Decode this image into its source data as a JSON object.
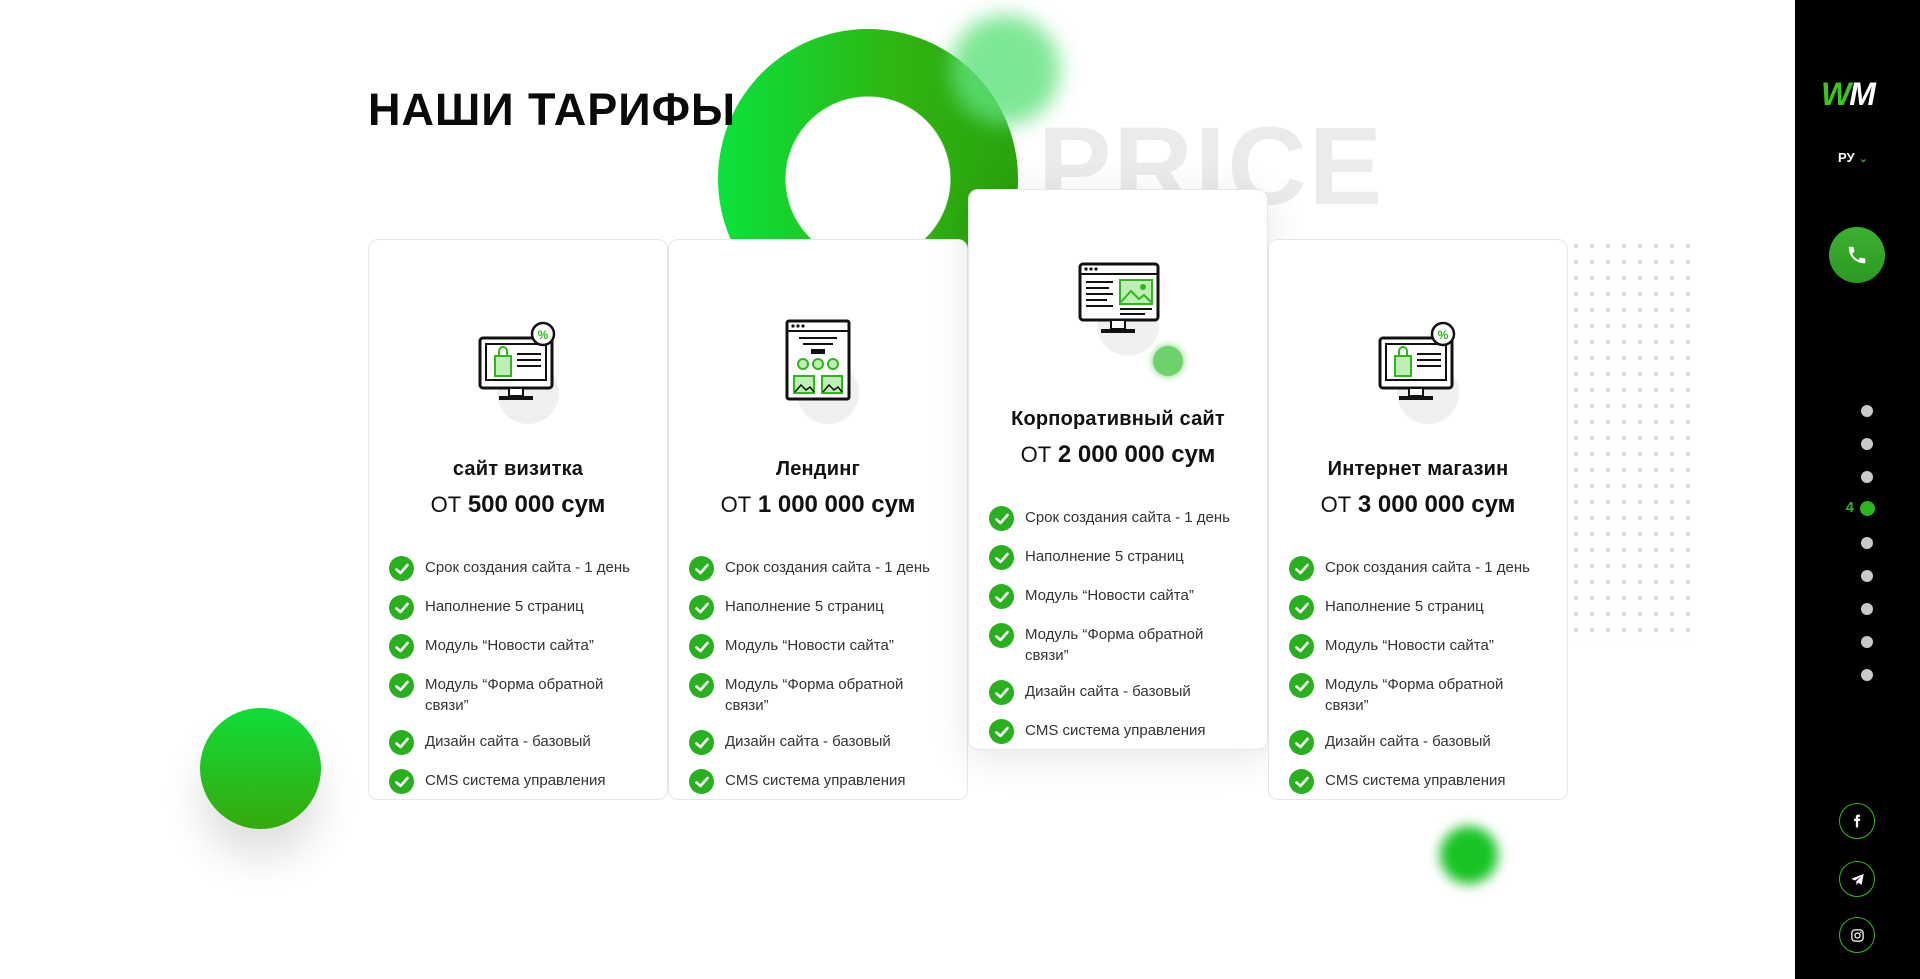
{
  "page": {
    "title": "НАШИ ТАРИФЫ",
    "watermark": "PRICE"
  },
  "colors": {
    "accent": "#2fb61e",
    "sidebar_bg": "#000000"
  },
  "cards": [
    {
      "icon": "shop-monitor-icon",
      "name": "сайт визитка",
      "price_prefix": "ОТ",
      "price": "500 000 сум",
      "features": [
        "Срок создания сайта - 1 день",
        "Наполнение 5 страниц",
        "Модуль “Новости сайта”",
        "Модуль “Форма обратной связи”",
        "Дизайн сайта - базовый",
        "CMS система управления"
      ]
    },
    {
      "icon": "landing-page-icon",
      "name": "Лендинг",
      "price_prefix": "ОТ",
      "price": "1 000 000 сум",
      "features": [
        "Срок создания сайта - 1 день",
        "Наполнение 5 страниц",
        "Модуль “Новости сайта”",
        "Модуль “Форма обратной связи”",
        "Дизайн сайта - базовый",
        "CMS система управления"
      ]
    },
    {
      "icon": "corporate-monitor-icon",
      "name": "Корпоративный сайт",
      "price_prefix": "ОТ",
      "price": "2 000 000 сум",
      "features": [
        "Срок создания сайта - 1 день",
        "Наполнение 5 страниц",
        "Модуль “Новости сайта”",
        "Модуль “Форма обратной связи”",
        "Дизайн сайта - базовый",
        "CMS система управления"
      ]
    },
    {
      "icon": "shop-monitor-icon",
      "name": "Интернет магазин",
      "price_prefix": "ОТ",
      "price": "3 000 000 сум",
      "features": [
        "Срок создания сайта - 1 день",
        "Наполнение 5 страниц",
        "Модуль “Новости сайта”",
        "Модуль “Форма обратной связи”",
        "Дизайн сайта - базовый",
        "CMS система управления"
      ]
    }
  ],
  "sidebar": {
    "logo_w": "W",
    "logo_m": "M",
    "language": "РУ",
    "phone_icon": "phone-icon",
    "pager": {
      "active_number": "4",
      "total": 9,
      "active_index": 4
    },
    "social": [
      "facebook-icon",
      "telegram-icon",
      "instagram-icon"
    ]
  }
}
